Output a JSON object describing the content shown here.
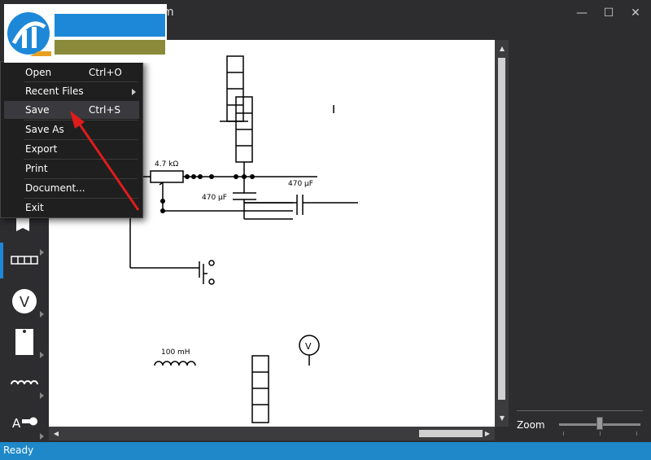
{
  "window": {
    "title_fragment": "m",
    "minimize": "—",
    "maximize": "☐",
    "close": "✕"
  },
  "menu": {
    "items": [
      {
        "label": "Open",
        "shortcut": "Ctrl+O"
      },
      {
        "label": "Recent Files",
        "shortcut": ""
      },
      {
        "label": "Save",
        "shortcut": "Ctrl+S"
      },
      {
        "label": "Save As",
        "shortcut": ""
      },
      {
        "label": "Export",
        "shortcut": ""
      },
      {
        "label": "Print",
        "shortcut": ""
      },
      {
        "label": "Document...",
        "shortcut": ""
      },
      {
        "label": "Exit",
        "shortcut": ""
      }
    ]
  },
  "toolbar": {
    "tools": [
      "flag-icon",
      "grid-icon",
      "voltmeter-icon",
      "component-icon",
      "inductor-icon",
      "text-tool-icon"
    ],
    "voltmeter_glyph": "V",
    "text_glyph": "A"
  },
  "canvas": {
    "labels": {
      "resistor": "4.7 kΩ",
      "cap1": "470 µF",
      "cap2": "470 µF",
      "inductor": "100 mH",
      "voltmeter": "V"
    }
  },
  "zoom": {
    "label": "Zoom",
    "level_fraction": 0.5
  },
  "status": {
    "text": "Ready"
  },
  "colors": {
    "accent": "#1e88c8",
    "annotation_arrow": "#e01b1b"
  }
}
